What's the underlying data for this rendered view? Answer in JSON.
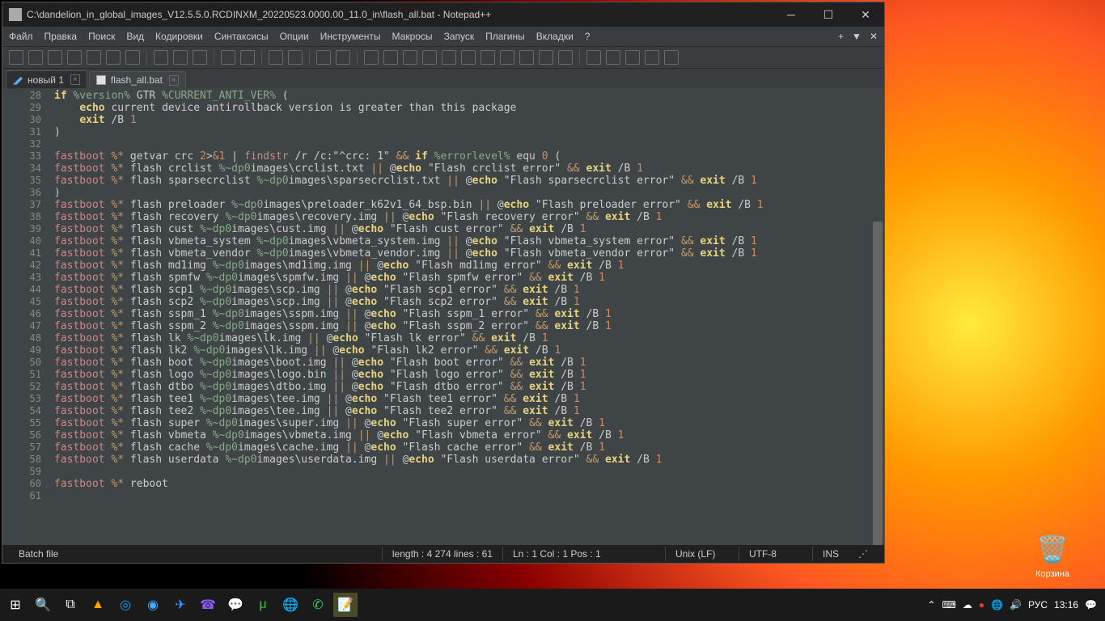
{
  "window": {
    "title": "C:\\dandelion_in_global_images_V12.5.5.0.RCDINXM_20220523.0000.00_11.0_in\\flash_all.bat - Notepad++"
  },
  "menu": {
    "items": [
      "Файл",
      "Правка",
      "Поиск",
      "Вид",
      "Кодировки",
      "Синтаксисы",
      "Опции",
      "Инструменты",
      "Макросы",
      "Запуск",
      "Плагины",
      "Вкладки",
      "?"
    ]
  },
  "tabs": {
    "tab1": "новый 1",
    "tab2": "flash_all.bat"
  },
  "code": {
    "lines": [
      {
        "n": 28,
        "html": "<span class='kw1'>if</span> <span class='var'>%version%</span> GTR <span class='var'>%CURRENT_ANTI_VER%</span> ("
      },
      {
        "n": 29,
        "html": "    <span class='kw1'>echo</span> current device antirollback version is greater than this package"
      },
      {
        "n": 30,
        "html": "    <span class='kw1'>exit</span> /B <span class='num'>1</span>"
      },
      {
        "n": 31,
        "html": ")"
      },
      {
        "n": 32,
        "html": ""
      },
      {
        "n": 33,
        "html": "<span class='kw2'>fastboot</span> <span class='op'>%*</span> getvar crc <span class='num'>2</span>&gt;<span class='num'>&amp;1</span> | <span class='kw2'>findstr</span> /r /c:\"^crc: 1\" <span class='op'>&amp;&amp;</span> <span class='kw1'>if</span> <span class='var'>%errorlevel%</span> equ <span class='num'>0</span> ("
      },
      {
        "n": 34,
        "html": "<span class='kw2'>fastboot</span> <span class='op'>%*</span> flash crclist <span class='path'>%~dp0</span>images\\crclist.txt <span class='op'>||</span> @<span class='kw1'>echo</span> \"Flash crclist error\" <span class='op'>&amp;&amp;</span> <span class='kw1'>exit</span> /B <span class='num'>1</span>"
      },
      {
        "n": 35,
        "html": "<span class='kw2'>fastboot</span> <span class='op'>%*</span> flash sparsecrclist <span class='path'>%~dp0</span>images\\sparsecrclist.txt <span class='op'>||</span> @<span class='kw1'>echo</span> \"Flash sparsecrclist error\" <span class='op'>&amp;&amp;</span> <span class='kw1'>exit</span> /B <span class='num'>1</span>"
      },
      {
        "n": 36,
        "html": ")"
      },
      {
        "n": 37,
        "html": "<span class='kw2'>fastboot</span> <span class='op'>%*</span> flash preloader <span class='path'>%~dp0</span>images\\preloader_k62v1_64_bsp.bin <span class='op'>||</span> @<span class='kw1'>echo</span> \"Flash preloader error\" <span class='op'>&amp;&amp;</span> <span class='kw1'>exit</span> /B <span class='num'>1</span>"
      },
      {
        "n": 38,
        "html": "<span class='kw2'>fastboot</span> <span class='op'>%*</span> flash recovery <span class='path'>%~dp0</span>images\\recovery.img <span class='op'>||</span> @<span class='kw1'>echo</span> \"Flash recovery error\" <span class='op'>&amp;&amp;</span> <span class='kw1'>exit</span> /B <span class='num'>1</span>"
      },
      {
        "n": 39,
        "html": "<span class='kw2'>fastboot</span> <span class='op'>%*</span> flash cust <span class='path'>%~dp0</span>images\\cust.img <span class='op'>||</span> @<span class='kw1'>echo</span> \"Flash cust error\" <span class='op'>&amp;&amp;</span> <span class='kw1'>exit</span> /B <span class='num'>1</span>"
      },
      {
        "n": 40,
        "html": "<span class='kw2'>fastboot</span> <span class='op'>%*</span> flash vbmeta_system <span class='path'>%~dp0</span>images\\vbmeta_system.img <span class='op'>||</span> @<span class='kw1'>echo</span> \"Flash vbmeta_system error\" <span class='op'>&amp;&amp;</span> <span class='kw1'>exit</span> /B <span class='num'>1</span>"
      },
      {
        "n": 41,
        "html": "<span class='kw2'>fastboot</span> <span class='op'>%*</span> flash vbmeta_vendor <span class='path'>%~dp0</span>images\\vbmeta_vendor.img <span class='op'>||</span> @<span class='kw1'>echo</span> \"Flash vbmeta_vendor error\" <span class='op'>&amp;&amp;</span> <span class='kw1'>exit</span> /B <span class='num'>1</span>"
      },
      {
        "n": 42,
        "html": "<span class='kw2'>fastboot</span> <span class='op'>%*</span> flash md1img <span class='path'>%~dp0</span>images\\md1img.img <span class='op'>||</span> @<span class='kw1'>echo</span> \"Flash md1img error\" <span class='op'>&amp;&amp;</span> <span class='kw1'>exit</span> /B <span class='num'>1</span>"
      },
      {
        "n": 43,
        "html": "<span class='kw2'>fastboot</span> <span class='op'>%*</span> flash spmfw <span class='path'>%~dp0</span>images\\spmfw.img <span class='op'>||</span> @<span class='kw1'>echo</span> \"Flash spmfw error\" <span class='op'>&amp;&amp;</span> <span class='kw1'>exit</span> /B <span class='num'>1</span>"
      },
      {
        "n": 44,
        "html": "<span class='kw2'>fastboot</span> <span class='op'>%*</span> flash scp1 <span class='path'>%~dp0</span>images\\scp.img <span class='op'>||</span> @<span class='kw1'>echo</span> \"Flash scp1 error\" <span class='op'>&amp;&amp;</span> <span class='kw1'>exit</span> /B <span class='num'>1</span>"
      },
      {
        "n": 45,
        "html": "<span class='kw2'>fastboot</span> <span class='op'>%*</span> flash scp2 <span class='path'>%~dp0</span>images\\scp.img <span class='op'>||</span> @<span class='kw1'>echo</span> \"Flash scp2 error\" <span class='op'>&amp;&amp;</span> <span class='kw1'>exit</span> /B <span class='num'>1</span>"
      },
      {
        "n": 46,
        "html": "<span class='kw2'>fastboot</span> <span class='op'>%*</span> flash sspm_1 <span class='path'>%~dp0</span>images\\sspm.img <span class='op'>||</span> @<span class='kw1'>echo</span> \"Flash sspm_1 error\" <span class='op'>&amp;&amp;</span> <span class='kw1'>exit</span> /B <span class='num'>1</span>"
      },
      {
        "n": 47,
        "html": "<span class='kw2'>fastboot</span> <span class='op'>%*</span> flash sspm_2 <span class='path'>%~dp0</span>images\\sspm.img <span class='op'>||</span> @<span class='kw1'>echo</span> \"Flash sspm_2 error\" <span class='op'>&amp;&amp;</span> <span class='kw1'>exit</span> /B <span class='num'>1</span>"
      },
      {
        "n": 48,
        "html": "<span class='kw2'>fastboot</span> <span class='op'>%*</span> flash lk <span class='path'>%~dp0</span>images\\lk.img <span class='op'>||</span> @<span class='kw1'>echo</span> \"Flash lk error\" <span class='op'>&amp;&amp;</span> <span class='kw1'>exit</span> /B <span class='num'>1</span>"
      },
      {
        "n": 49,
        "html": "<span class='kw2'>fastboot</span> <span class='op'>%*</span> flash lk2 <span class='path'>%~dp0</span>images\\lk.img <span class='op'>||</span> @<span class='kw1'>echo</span> \"Flash lk2 error\" <span class='op'>&amp;&amp;</span> <span class='kw1'>exit</span> /B <span class='num'>1</span>"
      },
      {
        "n": 50,
        "html": "<span class='kw2'>fastboot</span> <span class='op'>%*</span> flash boot <span class='path'>%~dp0</span>images\\boot.img <span class='op'>||</span> @<span class='kw1'>echo</span> \"Flash boot error\" <span class='op'>&amp;&amp;</span> <span class='kw1'>exit</span> /B <span class='num'>1</span>"
      },
      {
        "n": 51,
        "html": "<span class='kw2'>fastboot</span> <span class='op'>%*</span> flash logo <span class='path'>%~dp0</span>images\\logo.bin <span class='op'>||</span> @<span class='kw1'>echo</span> \"Flash logo error\" <span class='op'>&amp;&amp;</span> <span class='kw1'>exit</span> /B <span class='num'>1</span>"
      },
      {
        "n": 52,
        "html": "<span class='kw2'>fastboot</span> <span class='op'>%*</span> flash dtbo <span class='path'>%~dp0</span>images\\dtbo.img <span class='op'>||</span> @<span class='kw1'>echo</span> \"Flash dtbo error\" <span class='op'>&amp;&amp;</span> <span class='kw1'>exit</span> /B <span class='num'>1</span>"
      },
      {
        "n": 53,
        "html": "<span class='kw2'>fastboot</span> <span class='op'>%*</span> flash tee1 <span class='path'>%~dp0</span>images\\tee.img <span class='op'>||</span> @<span class='kw1'>echo</span> \"Flash tee1 error\" <span class='op'>&amp;&amp;</span> <span class='kw1'>exit</span> /B <span class='num'>1</span>"
      },
      {
        "n": 54,
        "html": "<span class='kw2'>fastboot</span> <span class='op'>%*</span> flash tee2 <span class='path'>%~dp0</span>images\\tee.img <span class='op'>||</span> @<span class='kw1'>echo</span> \"Flash tee2 error\" <span class='op'>&amp;&amp;</span> <span class='kw1'>exit</span> /B <span class='num'>1</span>"
      },
      {
        "n": 55,
        "html": "<span class='kw2'>fastboot</span> <span class='op'>%*</span> flash super <span class='path'>%~dp0</span>images\\super.img <span class='op'>||</span> @<span class='kw1'>echo</span> \"Flash super error\" <span class='op'>&amp;&amp;</span> <span class='kw1'>exit</span> /B <span class='num'>1</span>"
      },
      {
        "n": 56,
        "html": "<span class='kw2'>fastboot</span> <span class='op'>%*</span> flash vbmeta <span class='path'>%~dp0</span>images\\vbmeta.img <span class='op'>||</span> @<span class='kw1'>echo</span> \"Flash vbmeta error\" <span class='op'>&amp;&amp;</span> <span class='kw1'>exit</span> /B <span class='num'>1</span>"
      },
      {
        "n": 57,
        "html": "<span class='kw2'>fastboot</span> <span class='op'>%*</span> flash cache <span class='path'>%~dp0</span>images\\cache.img <span class='op'>||</span> @<span class='kw1'>echo</span> \"Flash cache error\" <span class='op'>&amp;&amp;</span> <span class='kw1'>exit</span> /B <span class='num'>1</span>"
      },
      {
        "n": 58,
        "html": "<span class='kw2'>fastboot</span> <span class='op'>%*</span> flash userdata <span class='path'>%~dp0</span>images\\userdata.img <span class='op'>||</span> @<span class='kw1'>echo</span> \"Flash userdata error\" <span class='op'>&amp;&amp;</span> <span class='kw1'>exit</span> /B <span class='num'>1</span>"
      },
      {
        "n": 59,
        "html": ""
      },
      {
        "n": 60,
        "html": "<span class='kw2'>fastboot</span> <span class='op'>%*</span> reboot"
      },
      {
        "n": 61,
        "html": ""
      }
    ]
  },
  "status": {
    "filetype": "Batch file",
    "length": "length : 4 274    lines : 61",
    "pos": "Ln : 1    Col : 1    Pos : 1",
    "eol": "Unix (LF)",
    "encoding": "UTF-8",
    "mode": "INS"
  },
  "desktop": {
    "recycle": "Корзина"
  },
  "systray": {
    "lang": "РУС",
    "time": "13:16"
  }
}
